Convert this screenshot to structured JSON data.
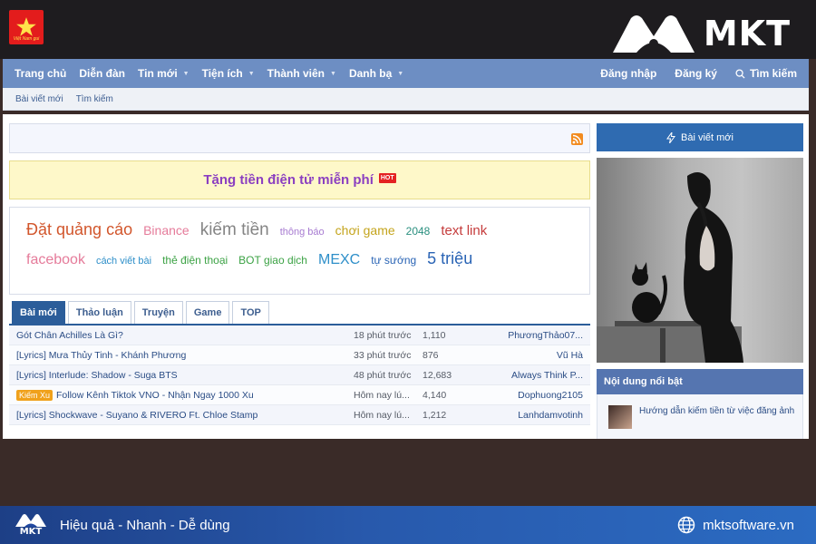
{
  "brand": {
    "mkt_word": "MKT",
    "footer_logo_word": "MKT",
    "slogan": "Hiệu quả - Nhanh - Dễ dùng",
    "website": "mktsoftware.vn",
    "site_logo_caption": "Việt Nam gui"
  },
  "nav": {
    "left": [
      {
        "label": "Trang chủ",
        "caret": false
      },
      {
        "label": "Diễn đàn",
        "caret": false
      },
      {
        "label": "Tin mới",
        "caret": true
      },
      {
        "label": "Tiện ích",
        "caret": true
      },
      {
        "label": "Thành viên",
        "caret": true
      },
      {
        "label": "Danh bạ",
        "caret": true
      }
    ],
    "login": "Đăng nhập",
    "register": "Đăng ký",
    "search": "Tìm kiếm"
  },
  "subnav": [
    "Bài viết mới",
    "Tìm kiếm"
  ],
  "promo": {
    "text": "Tặng tiền điện tử miễn phí",
    "badge": "HOT"
  },
  "tags": {
    "row1": [
      {
        "label": "Đặt quảng cáo",
        "color": "#d2562c",
        "size": 18
      },
      {
        "label": "Binance",
        "color": "#e57b9a",
        "size": 14
      },
      {
        "label": "kiếm tiền",
        "color": "#858585",
        "size": 19
      },
      {
        "label": "thông báo",
        "color": "#a77bd1",
        "size": 11
      },
      {
        "label": "chơi game",
        "color": "#c4a41c",
        "size": 14
      },
      {
        "label": "2048",
        "color": "#2a8f7f",
        "size": 12
      },
      {
        "label": "text link",
        "color": "#c53c3c",
        "size": 15
      }
    ],
    "row2": [
      {
        "label": "facebook",
        "color": "#e57b9a",
        "size": 16
      },
      {
        "label": "cách viết bài",
        "color": "#2e8fc9",
        "size": 11
      },
      {
        "label": "thẻ điện thoại",
        "color": "#3ba244",
        "size": 12
      },
      {
        "label": "BOT giao dịch",
        "color": "#3ba244",
        "size": 12
      },
      {
        "label": "MEXC",
        "color": "#2e8fc9",
        "size": 16
      },
      {
        "label": "tự sướng",
        "color": "#2a64b5",
        "size": 12
      },
      {
        "label": "5 triệu",
        "color": "#2a64b5",
        "size": 18
      }
    ]
  },
  "tabs": [
    {
      "label": "Bài mới",
      "active": true
    },
    {
      "label": "Thảo luận",
      "active": false
    },
    {
      "label": "Truyện",
      "active": false
    },
    {
      "label": "Game",
      "active": false
    },
    {
      "label": "TOP",
      "active": false
    }
  ],
  "threads": [
    {
      "prefix": "",
      "title": "Gót Chân Achilles Là Gì?",
      "time": "18 phút trước",
      "count": "1,110",
      "user": "PhươngThảo07..."
    },
    {
      "prefix": "",
      "title": "[Lyrics] Mưa Thủy Tinh - Khánh Phương",
      "time": "33 phút trước",
      "count": "876",
      "user": "Vũ Hà"
    },
    {
      "prefix": "",
      "title": "[Lyrics] Interlude: Shadow - Suga BTS",
      "time": "48 phút trước",
      "count": "12,683",
      "user": "Always Think P..."
    },
    {
      "prefix": "Kiếm Xu",
      "title": "Follow Kênh Tiktok VNO - Nhận Ngay 1000 Xu",
      "time": "Hôm nay lú...",
      "count": "4,140",
      "user": "Dophuong2105"
    },
    {
      "prefix": "",
      "title": "[Lyrics] Shockwave - Suyano & RIVERO Ft. Chloe Stamp",
      "time": "Hôm nay lú...",
      "count": "1,212",
      "user": "Lanhdamvotinh"
    }
  ],
  "sidebar": {
    "new_posts_button": "Bài viết mới",
    "featured_title": "Nội dung nổi bật",
    "featured_item": "Hướng dẫn kiếm tiền từ việc đăng ảnh"
  }
}
